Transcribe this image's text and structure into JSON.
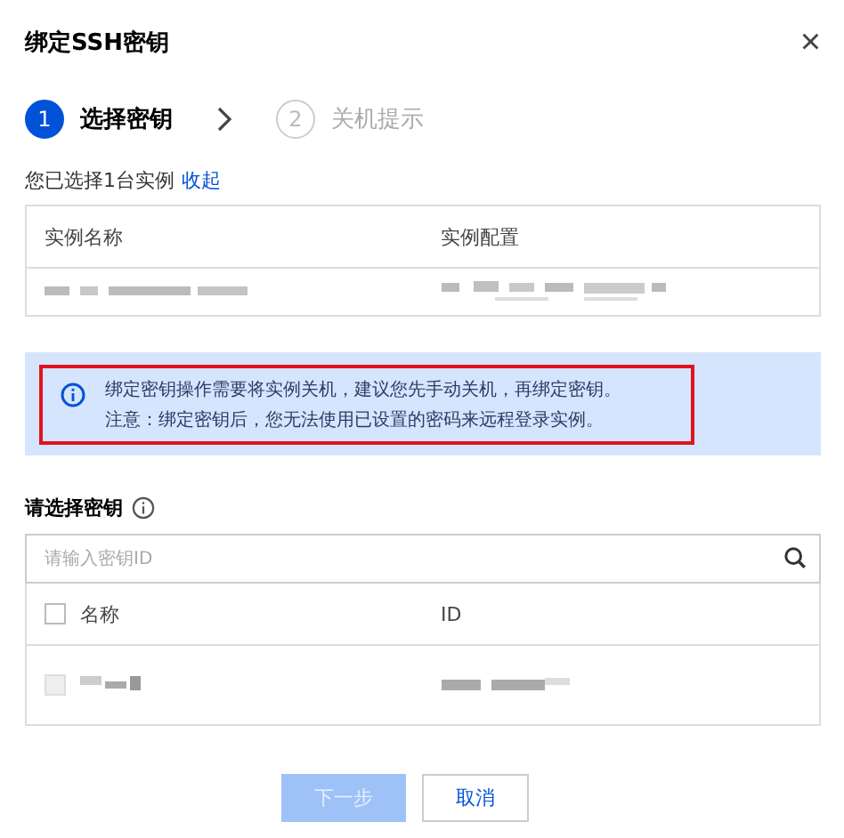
{
  "dialog": {
    "title": "绑定SSH密钥",
    "close": "×"
  },
  "steps": [
    {
      "number": "1",
      "label": "选择密钥",
      "selected": true
    },
    {
      "number": "2",
      "label": "关机提示",
      "selected": false
    }
  ],
  "selection": {
    "summary": "您已选择1台实例",
    "toggle": "收起"
  },
  "instance_table": {
    "columns": [
      "实例名称",
      "实例配置"
    ],
    "rows": [
      {
        "kind": "blurred"
      }
    ]
  },
  "notice": {
    "lines": [
      "绑定密钥操作需要将实例关机，建议您先手动关机，再绑定密钥。",
      "注意：绑定密钥后，您无法使用已设置的密码来远程登录实例。"
    ],
    "highlighted": true
  },
  "key_section": {
    "label": "请选择密钥",
    "search": {
      "placeholder": "请输入密钥ID"
    }
  },
  "key_table": {
    "header_checked": false,
    "columns": [
      "名称",
      "ID"
    ],
    "rows": [
      {
        "kind": "blurred",
        "disabled": true
      }
    ]
  },
  "buttons": [
    {
      "label": "下一步",
      "kind": "primary",
      "disabled": true
    },
    {
      "label": "取消",
      "kind": "secondary",
      "disabled": false
    }
  ]
}
